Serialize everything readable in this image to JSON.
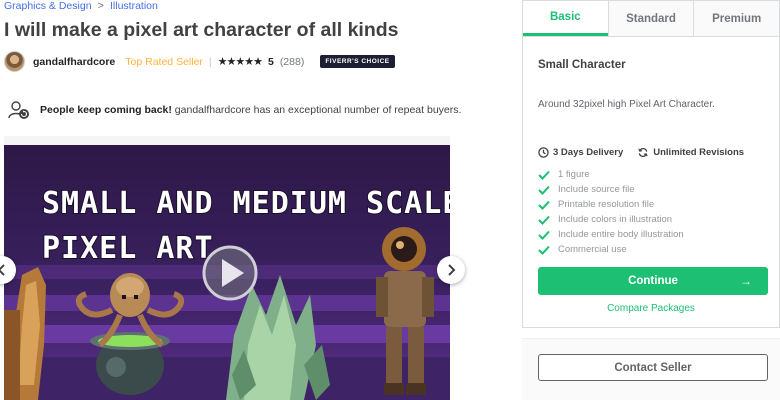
{
  "breadcrumb": {
    "category": "Graphics & Design",
    "subcategory": "Illustration",
    "separator": ">"
  },
  "gig": {
    "title": "I will make a pixel art character of all kinds"
  },
  "seller": {
    "name": "gandalfhardcore",
    "level": "Top Rated Seller",
    "separator": "|",
    "stars": "★★★★★",
    "rating": "5",
    "reviews": "(288)",
    "badge": "FIVERR'S CHOICE"
  },
  "repeat": {
    "lead": "People keep coming back!",
    "text": " gandalfhardcore has an exceptional number of repeat buyers."
  },
  "hero": {
    "line1": "SMALL AND MEDIUM SCALE",
    "line2": "PIXEL ART"
  },
  "package": {
    "tabs": [
      "Basic",
      "Standard",
      "Premium"
    ],
    "active_tab": "Basic",
    "title": "Small Character",
    "description": "Around 32pixel high Pixel Art Character.",
    "delivery": "3 Days Delivery",
    "revisions": "Unlimited Revisions",
    "features": [
      "1 figure",
      "Include source file",
      "Printable resolution file",
      "Include colors in illustration",
      "Include entire body illustration",
      "Commercial use"
    ],
    "continue_label": "Continue",
    "compare_label": "Compare Packages"
  },
  "contact": {
    "label": "Contact Seller"
  },
  "colors": {
    "accent": "#1dbf73",
    "top_rated": "#ffb33e",
    "link": "#446ee7",
    "badge_bg": "#1c1f33"
  }
}
